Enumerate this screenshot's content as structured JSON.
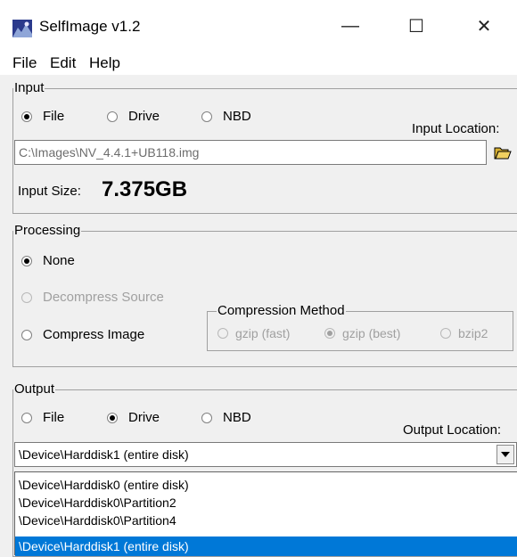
{
  "window": {
    "title": "SelfImage v1.2",
    "minimize_glyph": "—",
    "maximize_glyph": "☐",
    "close_glyph": "✕"
  },
  "menu": [
    "File",
    "Edit",
    "Help"
  ],
  "input": {
    "legend": "Input",
    "radios": [
      {
        "label": "File",
        "checked": true
      },
      {
        "label": "Drive",
        "checked": false
      },
      {
        "label": "NBD",
        "checked": false
      }
    ],
    "location_label": "Input Location:",
    "path": "C:\\Images\\NV_4.4.1+UB118.img",
    "size_label": "Input Size:",
    "size_value": "7.375GB"
  },
  "processing": {
    "legend": "Processing",
    "none_label": "None",
    "decompress_label": "Decompress Source",
    "compress_label": "Compress Image",
    "compression_legend": "Compression Method",
    "methods": [
      {
        "label": "gzip (fast)",
        "checked": false
      },
      {
        "label": "gzip (best)",
        "checked": true
      },
      {
        "label": "bzip2",
        "checked": false
      }
    ]
  },
  "output": {
    "legend": "Output",
    "radios": [
      {
        "label": "File",
        "checked": false
      },
      {
        "label": "Drive",
        "checked": true
      },
      {
        "label": "NBD",
        "checked": false
      }
    ],
    "location_label": "Output Location:",
    "selected": "\\Device\\Harddisk1 (entire disk)",
    "options": [
      "\\Device\\Harddisk0 (entire disk)",
      "\\Device\\Harddisk0\\Partition2",
      "\\Device\\Harddisk0\\Partition4",
      "\\Device\\Harddisk1 (entire disk)"
    ],
    "highlighted_index": 3
  },
  "colors": {
    "highlight": "#0078d7"
  }
}
